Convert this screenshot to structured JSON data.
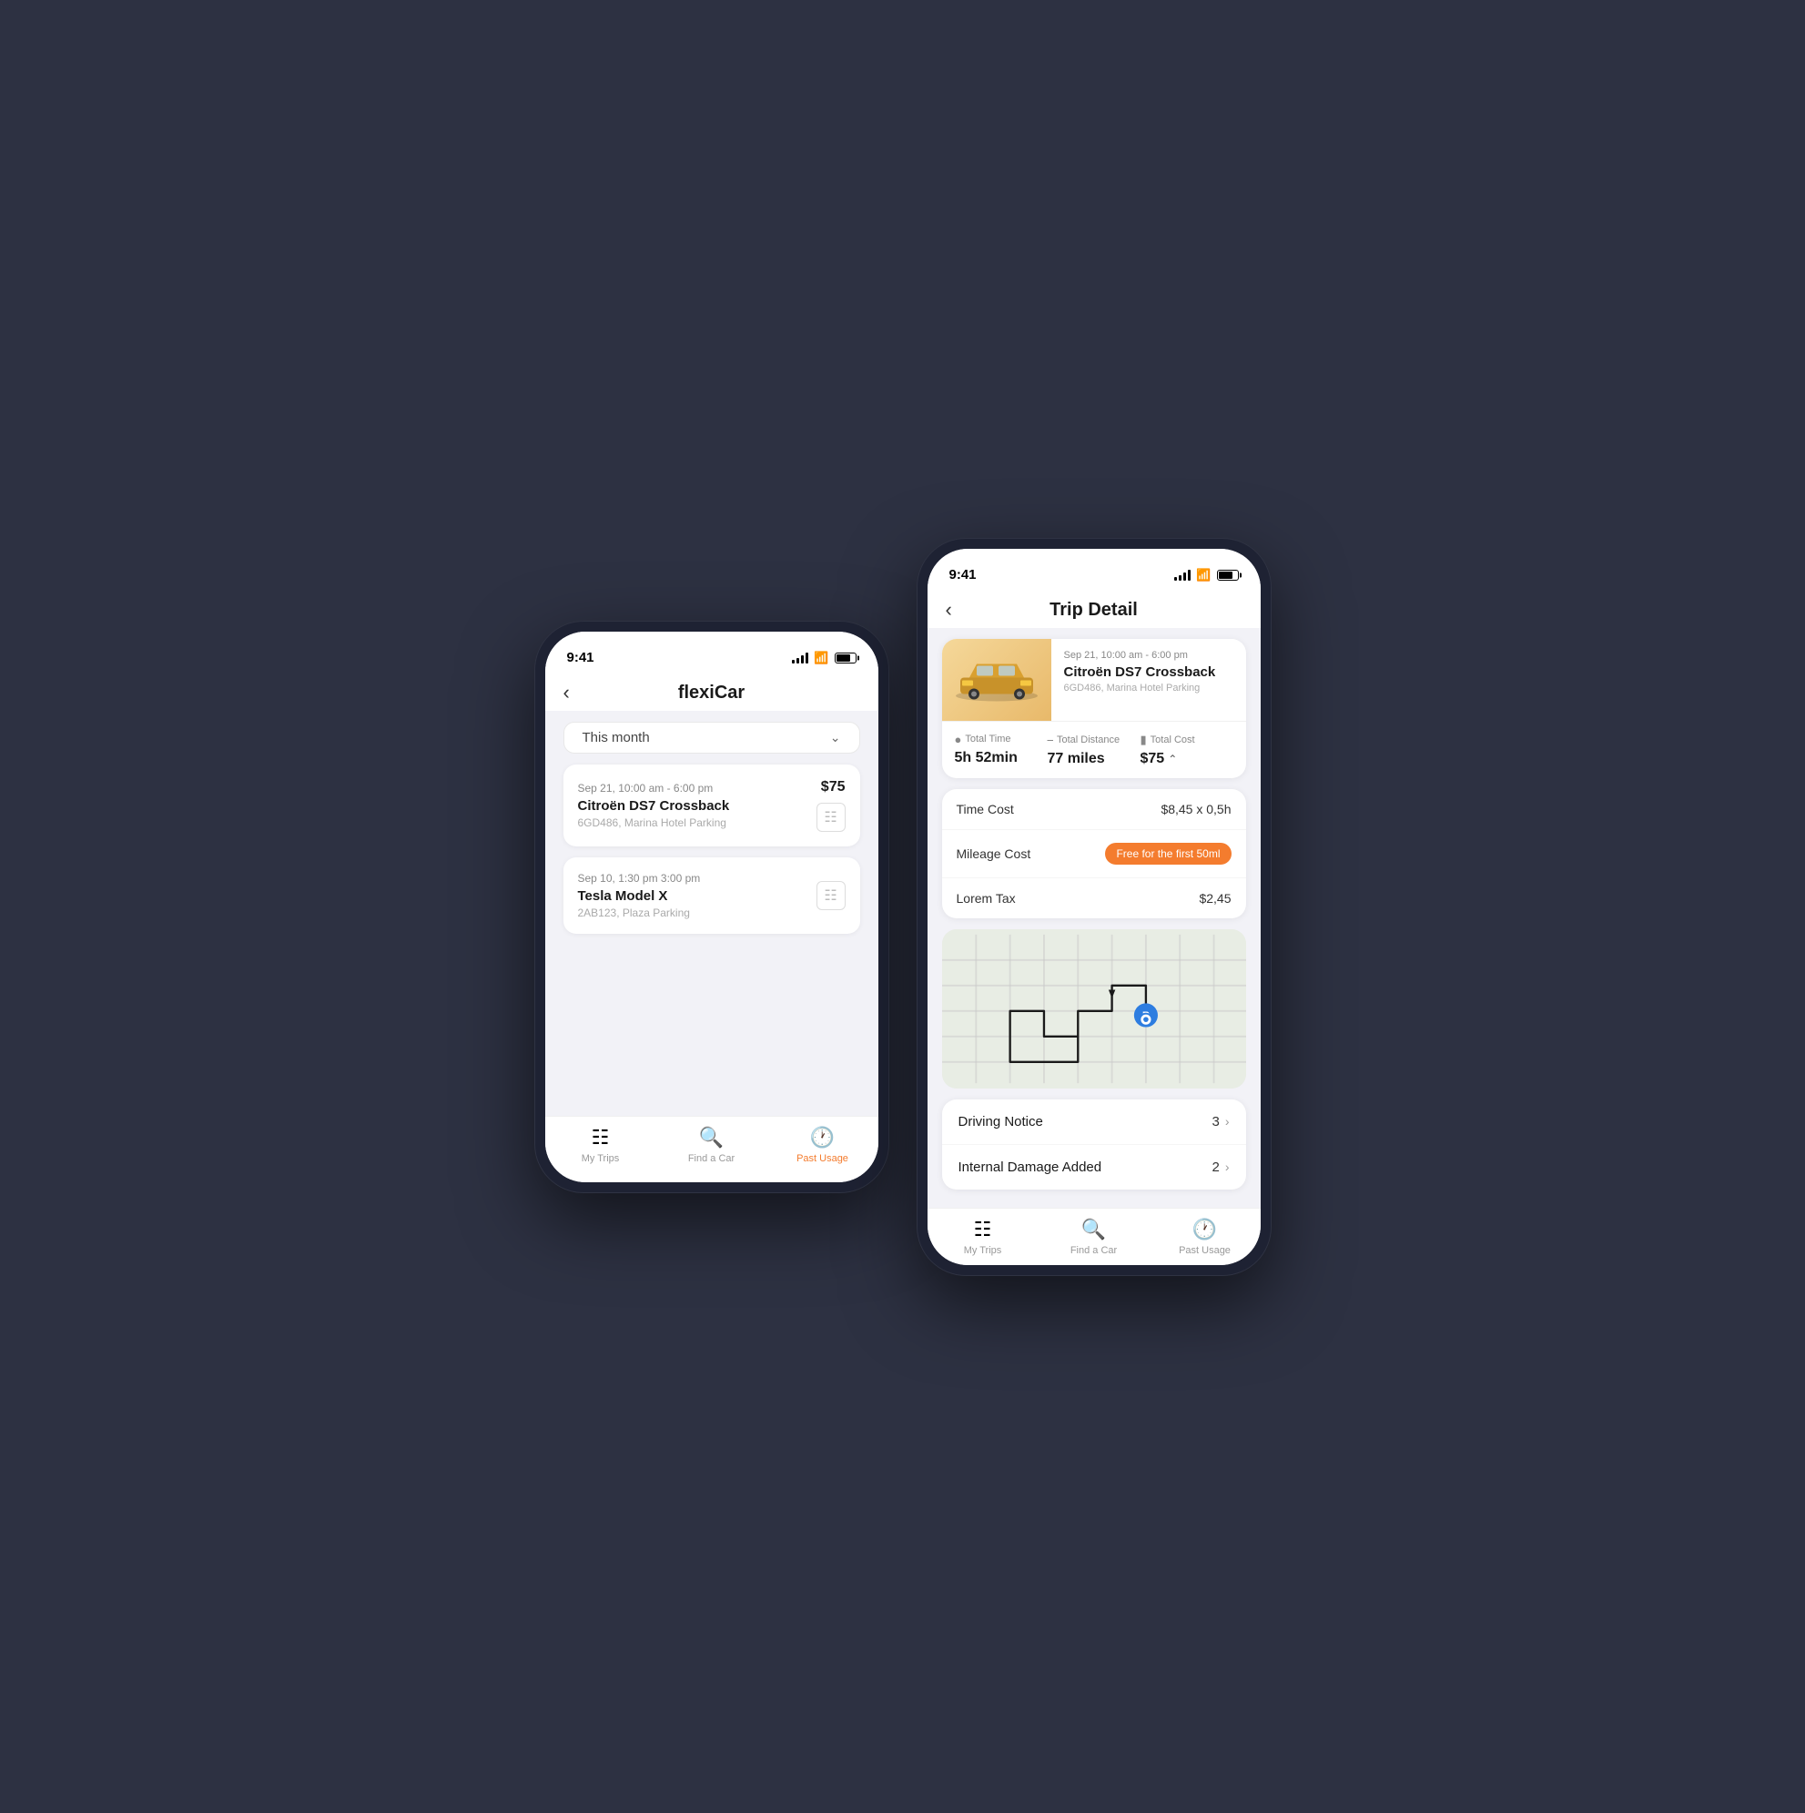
{
  "left_phone": {
    "status_time": "9:41",
    "title": "flexiCar",
    "filter": {
      "label": "This month",
      "icon": "chevron-down"
    },
    "trips": [
      {
        "date": "Sep 21, 10:00 am - 6:00 pm",
        "car": "Citroën DS7 Crossback",
        "location": "6GD486, Marina Hotel Parking",
        "price": "$75"
      },
      {
        "date": "Sep 10, 1:30 pm 3:00 pm",
        "car": "Tesla Model X",
        "location": "2AB123, Plaza Parking",
        "price": ""
      }
    ],
    "bottom_nav": [
      {
        "label": "My Trips",
        "active": false,
        "icon": "list"
      },
      {
        "label": "Find a Car",
        "active": false,
        "icon": "search"
      },
      {
        "label": "Past Usage",
        "active": true,
        "icon": "clock"
      }
    ]
  },
  "right_phone": {
    "status_time": "9:41",
    "title": "Trip Detail",
    "trip": {
      "date": "Sep 21, 10:00 am - 6:00 pm",
      "car": "Citroën DS7 Crossback",
      "location": "6GD486, Marina Hotel Parking"
    },
    "stats": [
      {
        "label": "Total Time",
        "value": "5h 52min",
        "icon": "clock"
      },
      {
        "label": "Total Distance",
        "value": "77 miles",
        "icon": "distance"
      },
      {
        "label": "Total Cost",
        "value": "$75",
        "icon": "card",
        "expandable": true
      }
    ],
    "cost_breakdown": [
      {
        "label": "Time Cost",
        "value": "$8,45 x 0,5h",
        "badge": false
      },
      {
        "label": "Mileage Cost",
        "value": "Free for the first 50ml",
        "badge": true
      },
      {
        "label": "Lorem Tax",
        "value": "$2,45",
        "badge": false
      }
    ],
    "notices": [
      {
        "label": "Driving Notice",
        "count": "3"
      },
      {
        "label": "Internal Damage Added",
        "count": "2"
      }
    ],
    "bottom_nav": [
      {
        "label": "My Trips",
        "active": false,
        "icon": "list"
      },
      {
        "label": "Find a Car",
        "active": false,
        "icon": "search"
      },
      {
        "label": "Past Usage",
        "active": false,
        "icon": "clock"
      }
    ]
  }
}
